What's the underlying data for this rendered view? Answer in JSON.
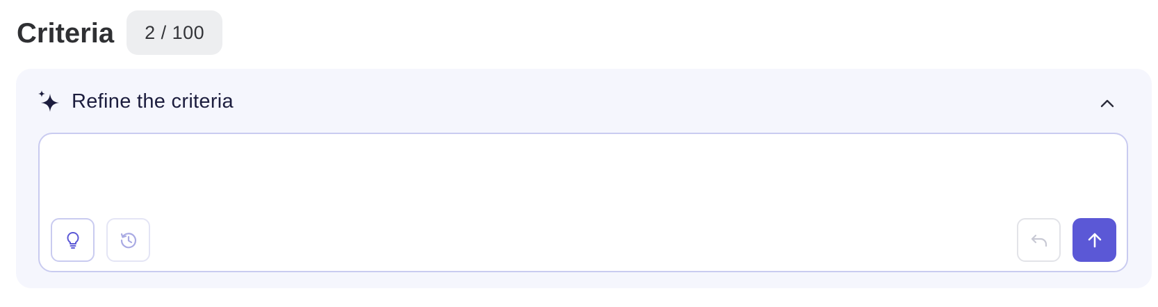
{
  "header": {
    "title": "Criteria",
    "count": "2 / 100"
  },
  "refine": {
    "title": "Refine the criteria",
    "input_value": "",
    "icons": {
      "sparkle": "sparkle-icon",
      "collapse": "chevron-up-icon",
      "ideas": "lightbulb-icon",
      "history": "history-icon",
      "undo": "undo-icon",
      "send": "arrow-up-icon"
    }
  },
  "colors": {
    "accent": "#5b58d6",
    "panel_bg": "#f5f6fd",
    "heading": "#2f3033",
    "badge_bg": "#edeef0"
  }
}
